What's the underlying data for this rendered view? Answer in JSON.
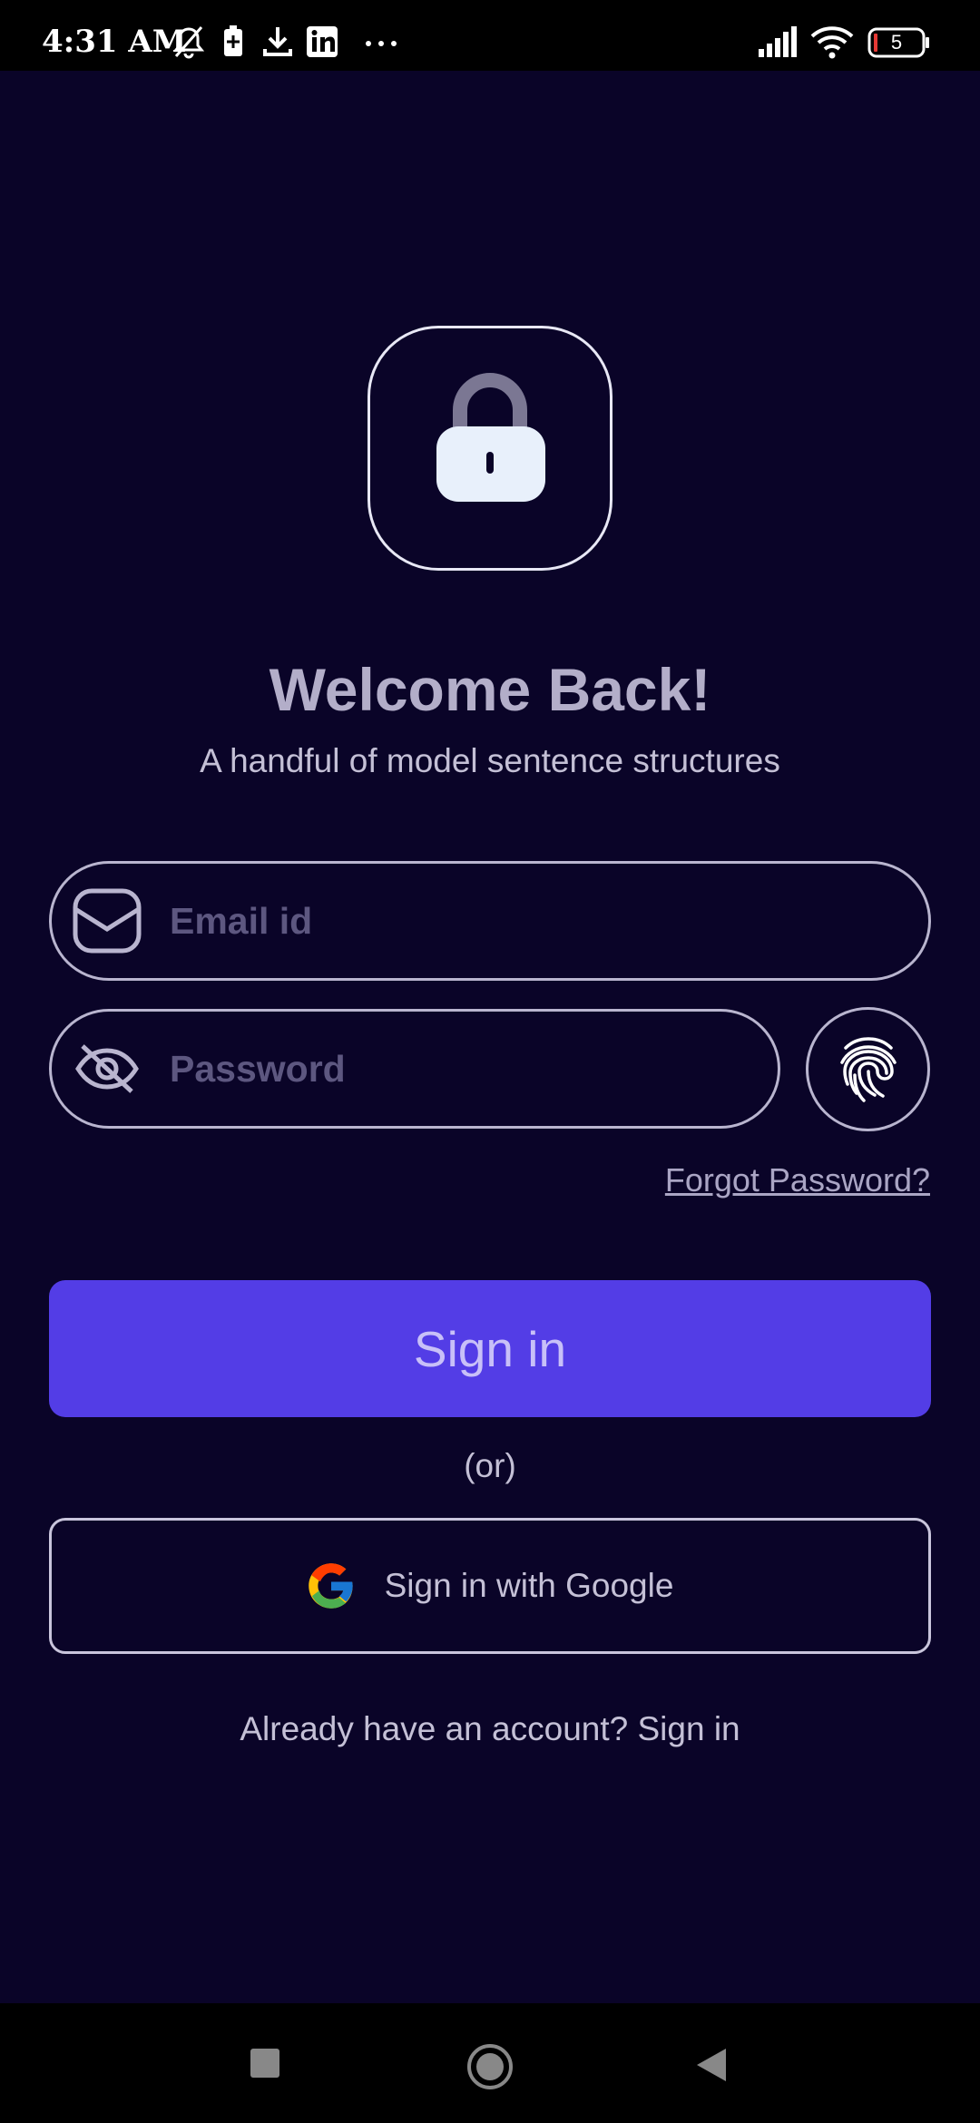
{
  "status_bar": {
    "time": "4:31 AM",
    "battery_level": "5",
    "icons": [
      "bell-off-icon",
      "battery-saver-icon",
      "download-icon",
      "linkedin-icon",
      "more-dots-icon",
      "signal-icon",
      "wifi-icon",
      "battery-icon"
    ]
  },
  "logo": {
    "icon": "lock-icon"
  },
  "header": {
    "title": "Welcome Back!",
    "subtitle": "A handful of model sentence structures"
  },
  "form": {
    "email_placeholder": "Email id",
    "email_value": "",
    "password_placeholder": "Password",
    "password_value": "",
    "forgot_password": "Forgot Password?",
    "sign_in_label": "Sign in",
    "or_text": "(or)",
    "google_label": "Sign in with Google",
    "already_account": "Already have an account? Sign in"
  },
  "colors": {
    "background": "#0a0428",
    "primary": "#533de6",
    "border": "#b9b5cf",
    "text_muted": "#c4c0d6"
  },
  "nav_bar": {
    "icons": [
      "recents-square-icon",
      "home-circle-icon",
      "back-triangle-icon"
    ]
  }
}
